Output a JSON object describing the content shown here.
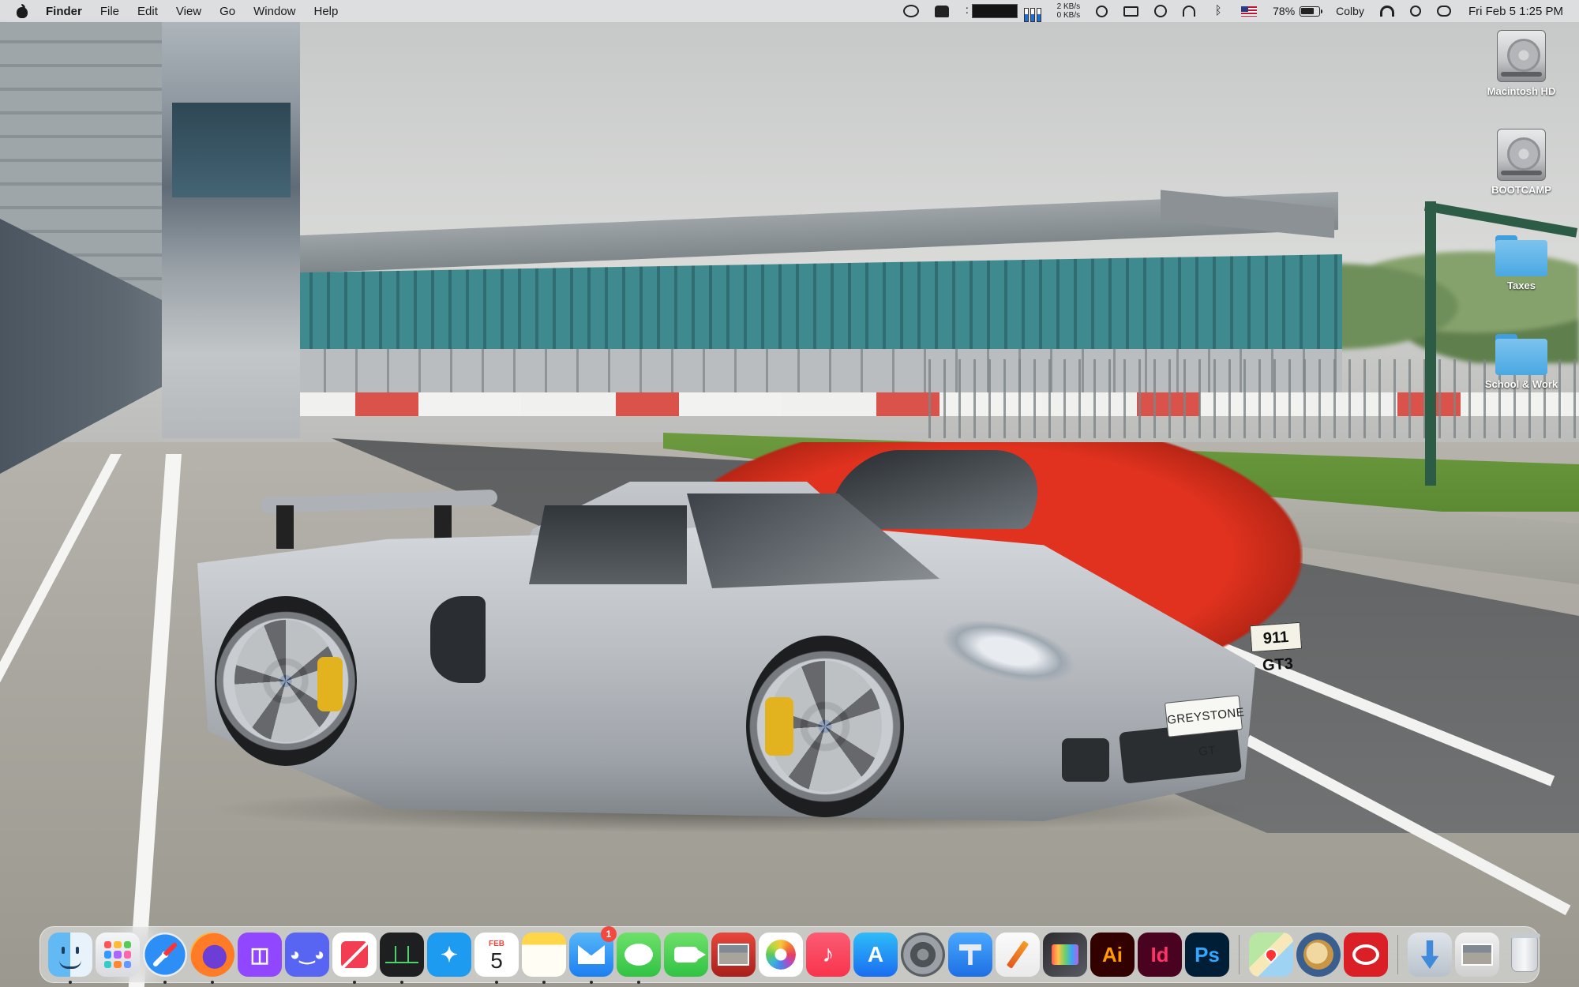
{
  "menubar": {
    "app_name": "Finder",
    "menus": [
      "File",
      "Edit",
      "View",
      "Go",
      "Window",
      "Help"
    ],
    "network": {
      "up": "2 KB/s",
      "down": "0 KB/s"
    },
    "battery_percent": "78%",
    "user_name": "Colby",
    "datetime": "Fri Feb 5  1:25 PM",
    "tray_icons": [
      "creative-cloud-icon",
      "notification-icon",
      "cpu-monitor-icon",
      "memory-monitor-icon",
      "network-rate-icon",
      "play-icon",
      "display-icon",
      "time-machine-icon",
      "headphones-icon",
      "bluetooth-icon",
      "us-flag-icon",
      "battery-icon",
      "wifi-icon",
      "spotlight-icon",
      "control-center-icon"
    ]
  },
  "desktop": {
    "icons": [
      {
        "label": "Macintosh HD",
        "icon": "hard-drive-icon"
      },
      {
        "label": "BOOTCAMP",
        "icon": "hard-drive-icon"
      },
      {
        "label": "Taxes",
        "icon": "folder-icon"
      },
      {
        "label": "School & Work",
        "icon": "folder-icon"
      }
    ],
    "wallpaper": {
      "silver_plate": "GREYSTONE GT",
      "red_plate": "911 GT3"
    }
  },
  "dock": {
    "apps": [
      {
        "name": "Finder",
        "running": true
      },
      {
        "name": "Launchpad",
        "running": false
      },
      {
        "name": "Safari",
        "running": true
      },
      {
        "name": "Firefox",
        "running": true
      },
      {
        "name": "Twitch",
        "running": false
      },
      {
        "name": "Discord",
        "running": false
      },
      {
        "name": "News",
        "running": true
      },
      {
        "name": "Activity Monitor",
        "running": true
      },
      {
        "name": "Twitter",
        "running": false
      },
      {
        "name": "Calendar",
        "running": true,
        "month": "FEB",
        "day": "5"
      },
      {
        "name": "Notes",
        "running": true
      },
      {
        "name": "Mail",
        "running": true,
        "badge": "1"
      },
      {
        "name": "Messages",
        "running": true
      },
      {
        "name": "FaceTime",
        "running": false
      },
      {
        "name": "Photo Booth",
        "running": false
      },
      {
        "name": "Photos",
        "running": false
      },
      {
        "name": "Music",
        "running": false
      },
      {
        "name": "App Store",
        "running": false
      },
      {
        "name": "System Preferences",
        "running": false
      },
      {
        "name": "Keynote",
        "running": false
      },
      {
        "name": "Pages",
        "running": false
      },
      {
        "name": "Final Cut Pro",
        "running": false
      },
      {
        "name": "Adobe Illustrator",
        "label": "Ai",
        "running": false
      },
      {
        "name": "Adobe InDesign",
        "label": "Id",
        "running": false
      },
      {
        "name": "Adobe Photoshop",
        "label": "Ps",
        "running": false
      },
      {
        "name": "Maps",
        "running": false
      },
      {
        "name": "Doge",
        "running": false
      },
      {
        "name": "Creative Cloud",
        "running": false
      },
      {
        "name": "Downloads",
        "running": false
      },
      {
        "name": "Screenshots",
        "running": false
      },
      {
        "name": "Trash",
        "running": false
      }
    ]
  }
}
